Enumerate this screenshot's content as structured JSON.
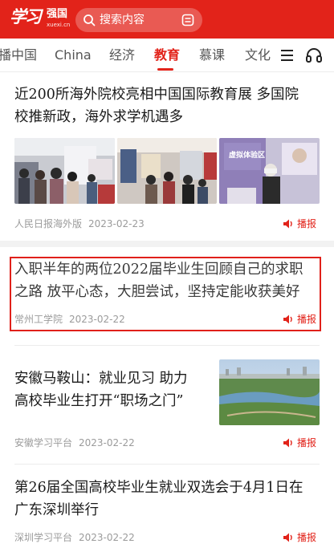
{
  "header": {
    "logo_main": "学习",
    "logo_side": "强国",
    "logo_url": "xuexi.cn",
    "search_placeholder": "搜索内容",
    "icons": [
      "search-icon",
      "scan-icon"
    ],
    "colors": {
      "brand": "#e2231a"
    }
  },
  "tabs": [
    {
      "label": "播中国"
    },
    {
      "label": "China"
    },
    {
      "label": "经济"
    },
    {
      "label": "教育",
      "active": true
    },
    {
      "label": "慕课"
    },
    {
      "label": "文化"
    }
  ],
  "articles": [
    {
      "title_line1": "近200所海外院校亮相中国国际教育展  多国院",
      "title_line2": "校推新政，海外求学机遇多",
      "source": "人民日报海外版",
      "date": "2023-02-23",
      "broadcast": "播报",
      "images": [
        "expo-crowd-photo",
        "expo-booth-photo",
        "vr-experience-photo"
      ],
      "image_caption": "虚拟体验区"
    },
    {
      "title_line1": "入职半年的两位2022届毕业生回顾自己的求职",
      "title_line2": "之路  放平心态，大胆尝试，坚持定能收获美好",
      "source": "常州工学院",
      "date": "2023-02-22",
      "broadcast": "播报"
    },
    {
      "title_line1": "安徽马鞍山：就业见习  助力",
      "title_line2": "高校毕业生打开“职场之门”",
      "source": "安徽学习平台",
      "date": "2023-02-22",
      "broadcast": "播报",
      "images": [
        "city-park-aerial-photo"
      ]
    },
    {
      "title_line1": "第26届全国高校毕业生就业双选会于4月1日在",
      "title_line2": "广东深圳举行",
      "source": "深圳学习平台",
      "date": "2023-02-22",
      "broadcast": "播报"
    }
  ]
}
